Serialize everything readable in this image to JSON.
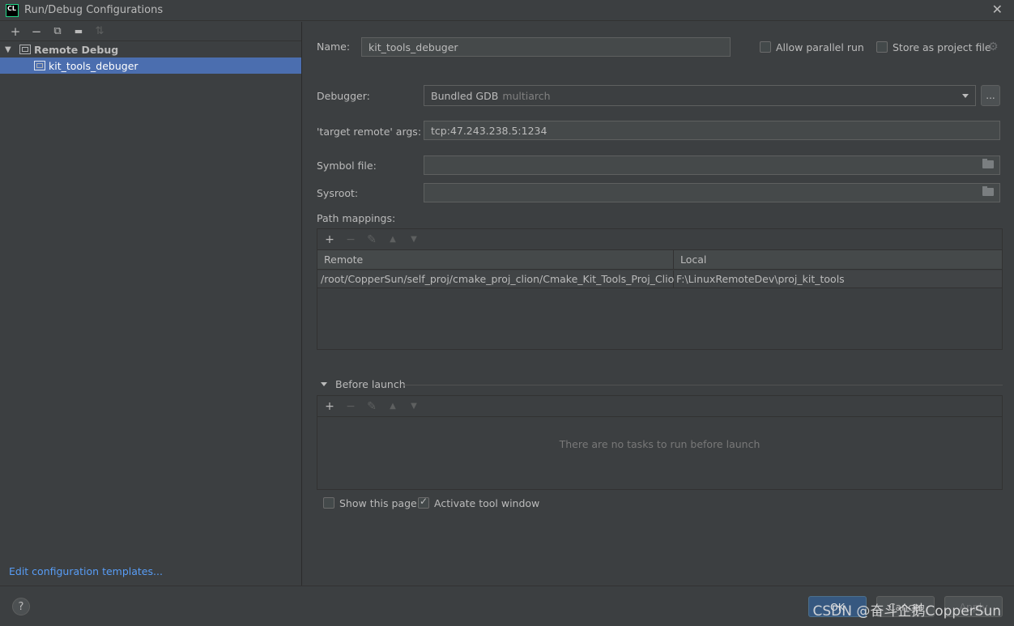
{
  "window": {
    "app_icon_text": "CL",
    "title": "Run/Debug Configurations",
    "close_glyph": "✕"
  },
  "left": {
    "toolbar": {
      "add": "+",
      "remove": "−",
      "copy": "⧉",
      "folder": "▬",
      "sort": "⇅"
    },
    "tree": {
      "group_label": "Remote Debug",
      "item_label": "kit_tools_debuger"
    },
    "edit_templates_link": "Edit configuration templates..."
  },
  "form": {
    "name_label": "Name:",
    "name_value": "kit_tools_debuger",
    "allow_parallel_label": "Allow parallel run",
    "allow_parallel_checked": false,
    "store_as_project_label": "Store as project file",
    "store_as_project_checked": false,
    "debugger_label": "Debugger:",
    "debugger_value": "Bundled GDB",
    "debugger_hint": "multiarch",
    "debugger_more_button": "...",
    "target_remote_label": "'target remote' args:",
    "target_remote_value": "tcp:47.243.238.5:1234",
    "symbol_file_label": "Symbol file:",
    "symbol_file_value": "",
    "sysroot_label": "Sysroot:",
    "sysroot_value": "",
    "path_mappings_label": "Path mappings:"
  },
  "path_mappings": {
    "toolbar": {
      "add": "+",
      "remove": "−",
      "edit": "✎",
      "up": "▲",
      "down": "▼"
    },
    "columns": [
      "Remote",
      "Local"
    ],
    "rows": [
      {
        "remote": "/root/CopperSun/self_proj/cmake_proj_clion/Cmake_Kit_Tools_Proj_Clion",
        "local": "F:\\LinuxRemoteDev\\proj_kit_tools"
      }
    ]
  },
  "before_launch": {
    "label": "Before launch",
    "toolbar": {
      "add": "+",
      "remove": "−",
      "edit": "✎",
      "up": "▲",
      "down": "▼"
    },
    "empty_message": "There are no tasks to run before launch"
  },
  "options": {
    "show_page_label": "Show this page",
    "show_page_checked": false,
    "activate_tool_label": "Activate tool window",
    "activate_tool_checked": true
  },
  "bottom": {
    "help": "?",
    "ok": "OK",
    "cancel": "Cancel",
    "apply": "Apply",
    "watermark": "CSDN @奋斗企鹅CopperSun"
  },
  "colors": {
    "background": "#3c3f41",
    "selection": "#4b6eaf",
    "link": "#589df6",
    "primary_button": "#365880"
  }
}
